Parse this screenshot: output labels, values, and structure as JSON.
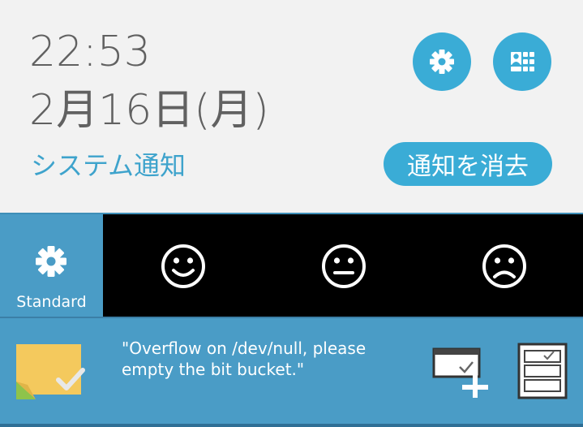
{
  "header": {
    "time": "22:53",
    "date": "2月16日(月)",
    "title": "システム通知",
    "clear_label": "通知を消去"
  },
  "modes": {
    "standard_label": "Standard"
  },
  "notification": {
    "message": "\"Overflow on /dev/null, please empty the bit bucket.\""
  },
  "colors": {
    "accent": "#3aacd6",
    "panel": "#4a9cc6",
    "text_gray": "#616161"
  },
  "icons": [
    "gear-icon",
    "contacts-grid-icon",
    "smiley-happy-icon",
    "smiley-neutral-icon",
    "smiley-sad-icon",
    "sticky-note-icon",
    "add-window-icon",
    "cabinet-icon"
  ]
}
